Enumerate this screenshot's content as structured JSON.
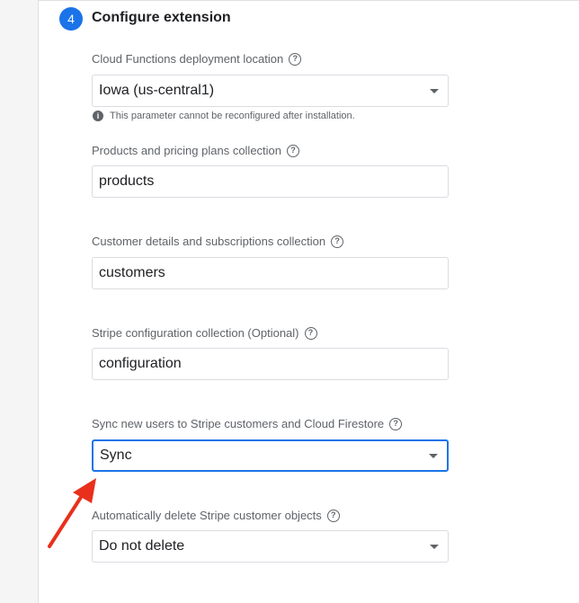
{
  "step": {
    "number": "4",
    "title": "Configure extension"
  },
  "fields": [
    {
      "label": "Cloud Functions deployment location",
      "type": "select",
      "value": "Iowa (us-central1)"
    },
    {
      "label": "Products and pricing plans collection",
      "type": "input",
      "value": "products"
    },
    {
      "label": "Customer details and subscriptions collection",
      "type": "input",
      "value": "customers"
    },
    {
      "label": "Stripe configuration collection (Optional)",
      "type": "input",
      "value": "configuration"
    },
    {
      "label": "Sync new users to Stripe customers and Cloud Firestore",
      "type": "select",
      "value": "Sync"
    },
    {
      "label": "Automatically delete Stripe customer objects",
      "type": "select",
      "value": "Do not delete"
    }
  ],
  "location_note": "This parameter cannot be reconfigured after installation.",
  "icons": {
    "help": "?",
    "info": "i"
  },
  "colors": {
    "accent": "#1a73e8",
    "annotation_arrow": "#e8301c"
  }
}
